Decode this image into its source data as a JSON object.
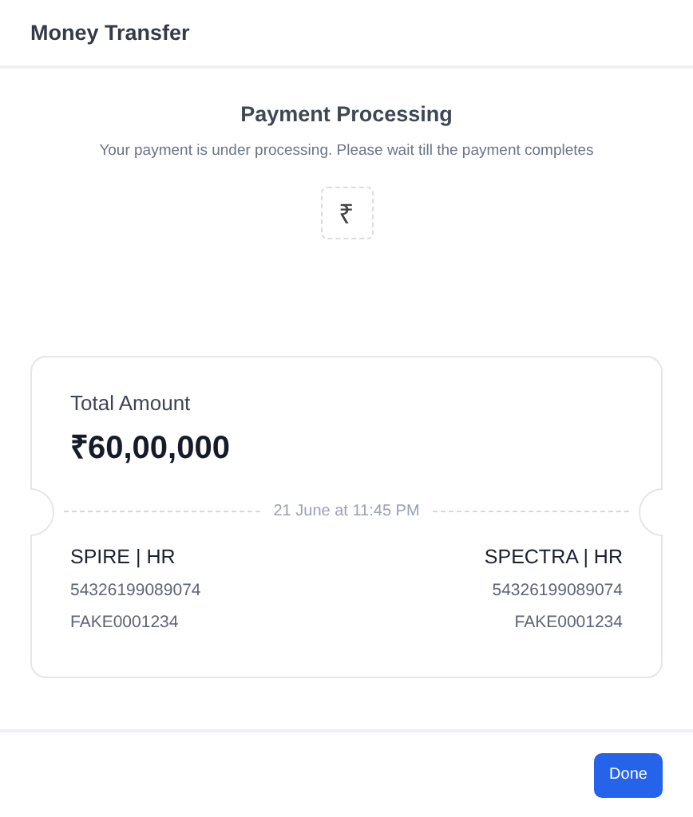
{
  "window": {
    "title": "Money Transfer"
  },
  "status": {
    "title": "Payment Processing",
    "message": "Your payment is under processing. Please wait till the payment completes",
    "icon": "₹"
  },
  "ticket": {
    "label": "Total Amount",
    "amount": "₹60,00,000",
    "timestamp": "21 June at 11:45 PM",
    "from": {
      "name": "SPIRE | HR",
      "account": "54326199089074",
      "code": "FAKE0001234"
    },
    "to": {
      "name": "SPECTRA | HR",
      "account": "54326199089074",
      "code": "FAKE0001234"
    }
  },
  "buttons": [
    "Done"
  ]
}
